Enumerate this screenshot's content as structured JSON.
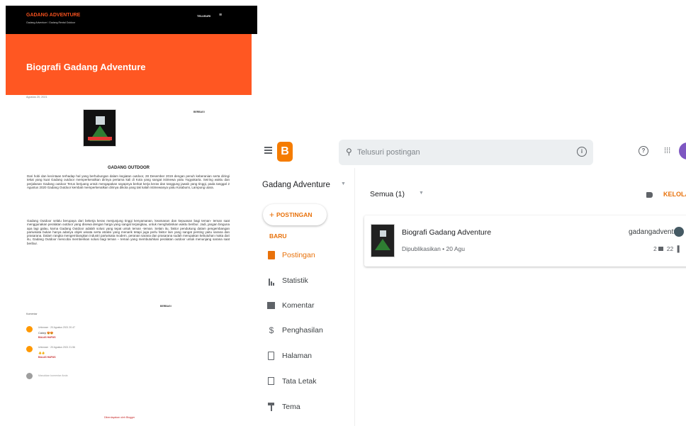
{
  "blog_page": {
    "site_title": "GADANG ADVENTURE",
    "site_subtitle": "Gadang Adventure / Gadang Rental Outdoor",
    "search_label": "TELUSURI",
    "menu_glyph": "≡",
    "post_title": "Biografi Gadang Adventure",
    "date": "Agustus 20, 2021",
    "share_label": "BERBAGI",
    "heading": "GADANG OUTDOOR",
    "paragraph1": "Dari hobi dan kecintaan terhadap hal yang berhubungan dalam kegiatan outdoor, 28 Desember 2019 dengan penuh keberanian serta diringi tekat yang kuat Gadang outdoor memperkenalkan dirinya pertama kali di Kota yang sangat istimewa yaitu Yogyakarta. Seiring waktu dan perjalanan Gadang outdoor Terus berjuang untuk mengapakan sayapnya berkat kerja keras dan tanggung jawab yang tinggi, pada tanggal 2 Agustus 2020 Gadang Outdoor kembali memperkenalkan dirinya dikota yang tak kalah istimewanya yaitu Kotabumi, Lampung utara.",
    "paragraph2": "Gadang Outdoor selalu berupaya dari bekerja keras menjunjung tinggi kenyamanan, keamanan dan kepuasan bagi teman- teman saat menggunakan peralatan outdoor yang disewa dengan harga yang sangat terjangkau, untuk menghabiskan waktu beribur. Jadi, jangan binguna apa lagi galau, karna Gadang Outdoor adalah solusi yang tepat untuk teman -teman. Selain itu, faktor pendukung dalam pengembangan pariwisata bukan hanya adanya objek wisata serta atraksi yang menarik tetapi juga perlu faktor lain yang sangat penting yaitu sarana dan prasarana. Dalam rangka mengembangkan industri pariwisata modern, peranan sarana dan prasarana sudah merupakan kebutuhan maka dari itu, Gadang Outdoor mencoba memberikan solusi bagi teman – teman yang membutuhkan peralatan outdoor untuk menunjang sarana saat beribur.",
    "comments_heading": "Komentar",
    "comments": [
      {
        "meta": "Unknown · 20 Agustus 2021 20.47",
        "text": "Cakep 😍😍",
        "actions": "BALAS  HAPUS"
      },
      {
        "meta": "Unknown · 20 Agustus 2021 21.56",
        "text": "👍👍",
        "actions": "BALAS  HAPUS"
      }
    ],
    "comment_placeholder": "Masukkan komentar Anda",
    "powered_by": "Diberdayakan oleh Blogger"
  },
  "dashboard": {
    "logo_letter": "B",
    "search_placeholder": "Telusuri postingan",
    "info_glyph": "i",
    "help_glyph": "?",
    "apps_glyph": "⋮⋮⋮",
    "blog_name": "Gadang Adventure",
    "caret": "▼",
    "new_post_label": "POSTINGAN BARU",
    "new_post_plus": "+",
    "nav": [
      {
        "label": "Postingan",
        "icon": "document-icon",
        "active": true
      },
      {
        "label": "Statistik",
        "icon": "bar-chart-icon",
        "active": false
      },
      {
        "label": "Komentar",
        "icon": "comment-icon",
        "active": false
      },
      {
        "label": "Penghasilan",
        "icon": "dollar-icon",
        "active": false
      },
      {
        "label": "Halaman",
        "icon": "pages-icon",
        "active": false
      },
      {
        "label": "Tata Letak",
        "icon": "layout-icon",
        "active": false
      },
      {
        "label": "Tema",
        "icon": "paint-roller-icon",
        "active": false
      }
    ],
    "filter_label": "Semua (1)",
    "manage_label": "KELOLA",
    "post": {
      "title": "Biografi Gadang Adventure",
      "status": "Dipublikasikan • 20 Agu",
      "author": "gadangadventure",
      "comment_count": "2",
      "view_count": "22"
    },
    "accent_color": "#e8710a"
  }
}
